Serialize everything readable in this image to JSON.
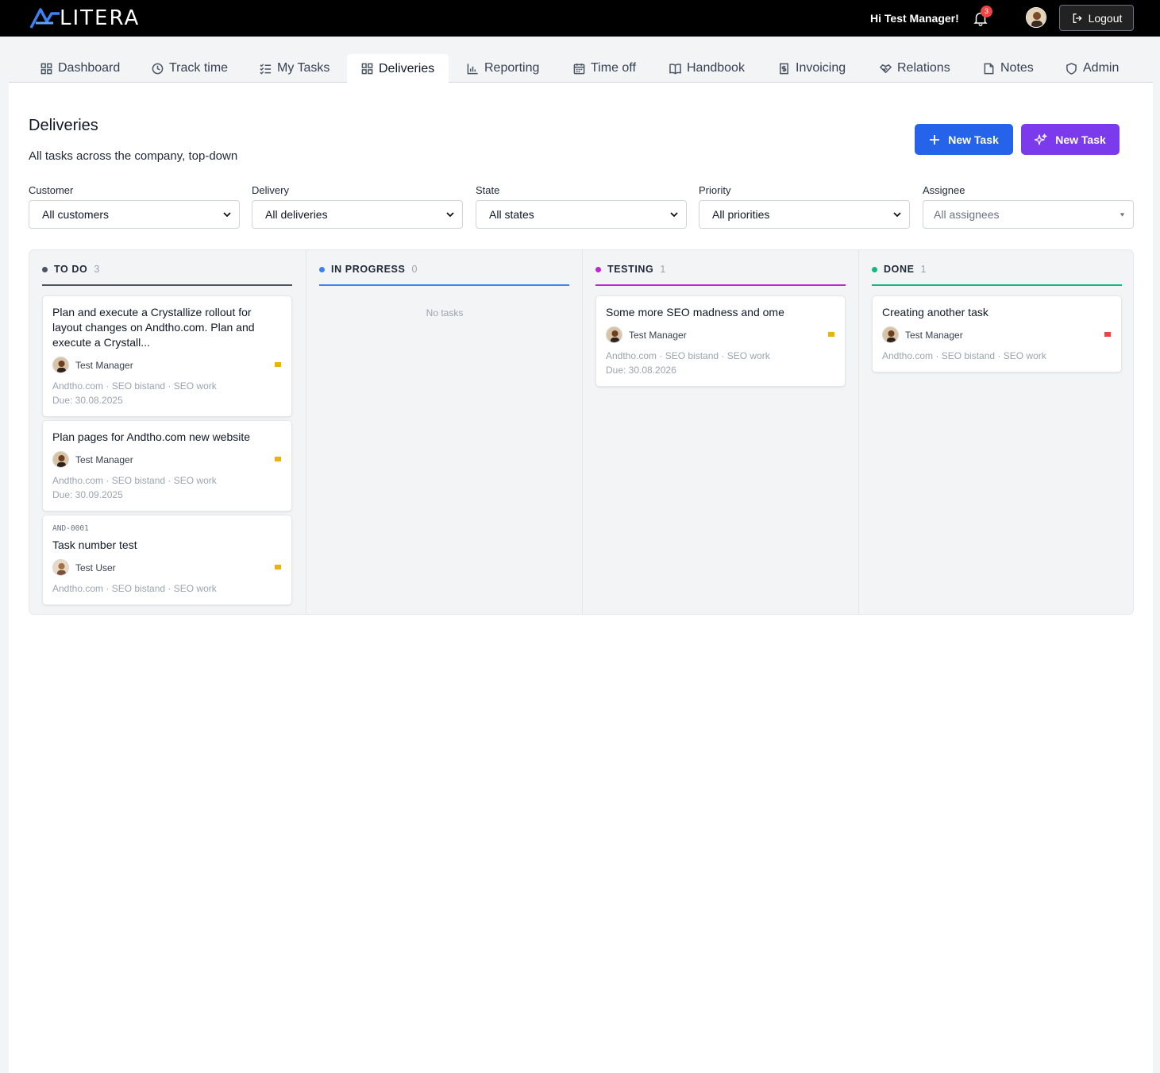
{
  "app": {
    "logo_text": "LITERA",
    "greeting": "Hi Test Manager!",
    "notification_count": "3",
    "logout_label": "Logout"
  },
  "tabs": [
    {
      "label": "Dashboard",
      "icon": "grid-icon"
    },
    {
      "label": "Track time",
      "icon": "clock-icon"
    },
    {
      "label": "My Tasks",
      "icon": "list-check-icon"
    },
    {
      "label": "Deliveries",
      "icon": "grid-icon",
      "active": true
    },
    {
      "label": "Reporting",
      "icon": "bar-chart-icon"
    },
    {
      "label": "Time off",
      "icon": "calendar-icon"
    },
    {
      "label": "Handbook",
      "icon": "book-icon"
    },
    {
      "label": "Invoicing",
      "icon": "invoice-icon"
    },
    {
      "label": "Relations",
      "icon": "handshake-icon"
    },
    {
      "label": "Notes",
      "icon": "note-icon"
    },
    {
      "label": "Admin",
      "icon": "shield-icon"
    }
  ],
  "page": {
    "title": "Deliveries",
    "subtitle": "All tasks across the company, top-down",
    "new_task_label": "New Task",
    "new_task_ai_label": "New Task"
  },
  "filters": {
    "customer": {
      "label": "Customer",
      "value": "All customers"
    },
    "delivery": {
      "label": "Delivery",
      "value": "All deliveries"
    },
    "state": {
      "label": "State",
      "value": "All states"
    },
    "priority": {
      "label": "Priority",
      "value": "All priorities"
    },
    "assignee": {
      "label": "Assignee",
      "placeholder": "All assignees"
    }
  },
  "columns": [
    {
      "name": "TO DO",
      "count": "3",
      "color": "#4b5563"
    },
    {
      "name": "IN PROGRESS",
      "count": "0",
      "color": "#3b82f6",
      "empty_text": "No tasks"
    },
    {
      "name": "TESTING",
      "count": "1",
      "color": "#c026d3"
    },
    {
      "name": "DONE",
      "count": "1",
      "color": "#10b981"
    }
  ],
  "cards": {
    "todo": [
      {
        "title": "Plan and execute a Crystallize rollout for layout changes on Andtho.com. Plan and execute a Crystall...",
        "assignee": "Test Manager",
        "meta": "Andtho.com · SEO bistand · SEO work",
        "due": "Due: 30.08.2025",
        "priority_color": "#eab308"
      },
      {
        "title": "Plan pages for Andtho.com new website",
        "assignee": "Test Manager",
        "meta": "Andtho.com · SEO bistand · SEO work",
        "due": "Due: 30.09.2025",
        "priority_color": "#eab308"
      },
      {
        "code": "AND-0001",
        "title": "Task number test",
        "assignee": "Test User",
        "meta": "Andtho.com · SEO bistand · SEO work",
        "priority_color": "#eab308"
      }
    ],
    "testing": [
      {
        "title": "Some more SEO madness and ome",
        "assignee": "Test Manager",
        "meta": "Andtho.com · SEO bistand · SEO work",
        "due": "Due: 30.08.2026",
        "priority_color": "#eab308"
      }
    ],
    "done": [
      {
        "title": "Creating another task",
        "assignee": "Test Manager",
        "meta": "Andtho.com · SEO bistand · SEO work",
        "priority_color": "#ef4444"
      }
    ]
  }
}
